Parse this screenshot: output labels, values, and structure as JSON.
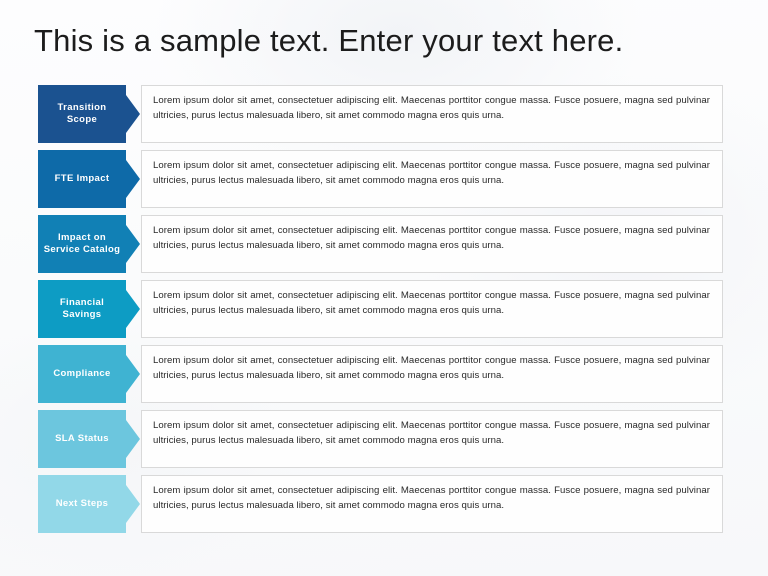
{
  "slide": {
    "title": "This is a sample text. Enter your text here.",
    "body_text": "Lorem ipsum dolor sit amet, consectetuer adipiscing elit. Maecenas porttitor congue massa. Fusce posuere, magna sed pulvinar ultricies, purus lectus malesuada libero, sit amet commodo magna eros quis urna.",
    "colors": {
      "background": "#fafbfc",
      "title_text": "#1c1c1c",
      "body_text": "#2a2a2a",
      "content_border": "#d9d9d9",
      "content_fill": "#fefefe",
      "label_text": "#ffffff"
    }
  },
  "rows": [
    {
      "label": "Transition Scope",
      "color": "#1b5290",
      "text": "Lorem ipsum dolor sit amet, consectetuer adipiscing elit. Maecenas porttitor congue massa. Fusce posuere, magna sed pulvinar ultricies, purus lectus malesuada libero, sit amet commodo magna eros quis urna."
    },
    {
      "label": "FTE Impact",
      "color": "#0e6aa8",
      "text": "Lorem ipsum dolor sit amet, consectetuer adipiscing elit. Maecenas porttitor congue massa. Fusce posuere, magna sed pulvinar ultricies, purus lectus malesuada libero, sit amet commodo magna eros quis urna."
    },
    {
      "label": "Impact on Service Catalog",
      "color": "#1180b5",
      "text": "Lorem ipsum dolor sit amet, consectetuer adipiscing elit. Maecenas porttitor congue massa. Fusce posuere, magna sed pulvinar ultricies, purus lectus malesuada libero, sit amet commodo magna eros quis urna."
    },
    {
      "label": "Financial Savings",
      "color": "#0d9cc4",
      "text": "Lorem ipsum dolor sit amet, consectetuer adipiscing elit. Maecenas porttitor congue massa. Fusce posuere, magna sed pulvinar ultricies, purus lectus malesuada libero, sit amet commodo magna eros quis urna."
    },
    {
      "label": "Compliance",
      "color": "#3fb3d2",
      "text": "Lorem ipsum dolor sit amet, consectetuer adipiscing elit. Maecenas porttitor congue massa. Fusce posuere, magna sed pulvinar ultricies, purus lectus malesuada libero, sit amet commodo magna eros quis urna."
    },
    {
      "label": "SLA Status",
      "color": "#6cc6de",
      "text": "Lorem ipsum dolor sit amet, consectetuer adipiscing elit. Maecenas porttitor congue massa. Fusce posuere, magna sed pulvinar ultricies, purus lectus malesuada libero, sit amet commodo magna eros quis urna."
    },
    {
      "label": "Next Steps",
      "color": "#92d8e8",
      "text": "Lorem ipsum dolor sit amet, consectetuer adipiscing elit. Maecenas porttitor congue massa. Fusce posuere, magna sed pulvinar ultricies, purus lectus malesuada libero, sit amet commodo magna eros quis urna."
    }
  ]
}
